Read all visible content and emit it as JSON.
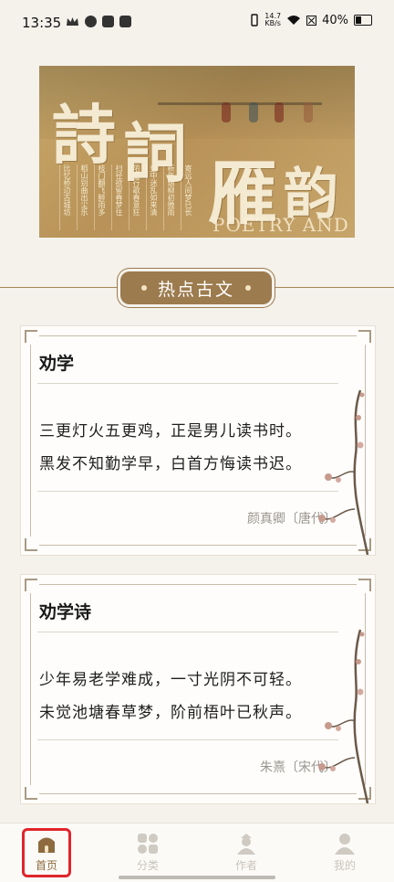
{
  "status_bar": {
    "time": "13:35",
    "net_speed_value": "14.7",
    "net_speed_unit": "KB/s",
    "battery": "40%"
  },
  "banner": {
    "chars": [
      "詩",
      "詞",
      "雁",
      "韵"
    ],
    "en_text": "POETRY AND",
    "columns": [
      "寄远人间梦已长",
      "新年烟柳初微雨",
      "壶中迷乱如来清",
      "陌上行歌春意狂",
      "扫径欲留春梦住",
      "枝门翻飞醉雨多",
      "稻山别曲出尘乐",
      "比忆桥边古城坊"
    ]
  },
  "section": {
    "title": "热点古文"
  },
  "poems": [
    {
      "title": "劝学",
      "lines": [
        "三更灯火五更鸡，正是男儿读书时。",
        "黑发不知勤学早，白首方悔读书迟。"
      ],
      "author": "颜真卿〔唐代〕"
    },
    {
      "title": "劝学诗",
      "lines": [
        "少年易老学难成，一寸光阴不可轻。",
        "未觉池塘春草梦，阶前梧叶已秋声。"
      ],
      "author": "朱熹〔宋代〕"
    }
  ],
  "nav": {
    "items": [
      {
        "label": "首页",
        "icon": "home-icon",
        "active": true
      },
      {
        "label": "分类",
        "icon": "category-icon",
        "active": false
      },
      {
        "label": "作者",
        "icon": "author-icon",
        "active": false
      },
      {
        "label": "我的",
        "icon": "profile-icon",
        "active": false
      }
    ],
    "active_color": "#8d6b3f",
    "highlight_color": "#e0252b"
  }
}
